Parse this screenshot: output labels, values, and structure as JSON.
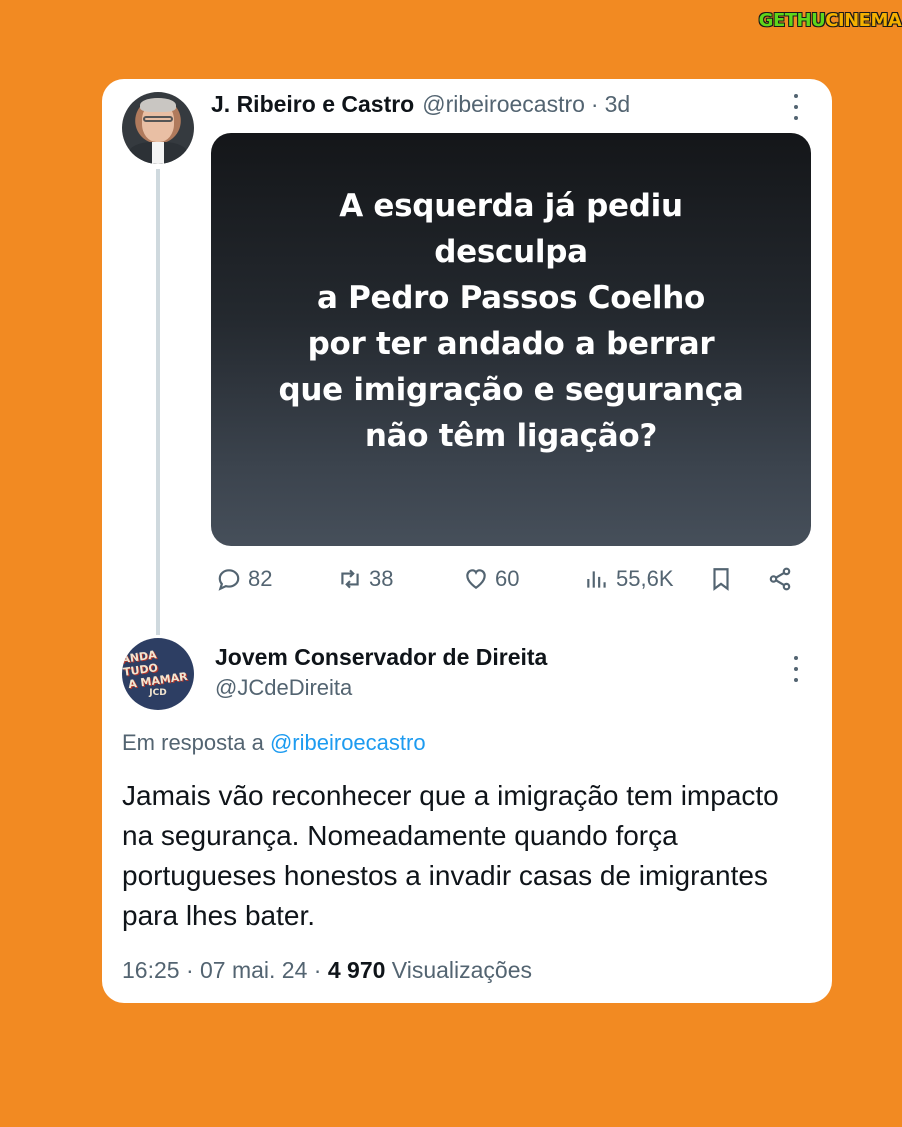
{
  "watermark": {
    "part1": "GETHU",
    "part2": "CINEMA"
  },
  "tweet1": {
    "author_name": "J. Ribeiro e Castro",
    "author_handle": "@ribeiroecastro",
    "separator": "·",
    "time": "3d",
    "image_text_lines": [
      "A esquerda já pediu",
      "desculpa",
      "a Pedro Passos Coelho",
      "por ter andado a berrar",
      "que imigração e segurança",
      "não têm ligação?"
    ],
    "stats": {
      "replies": "82",
      "retweets": "38",
      "likes": "60",
      "views": "55,6K"
    }
  },
  "tweet2": {
    "author_name": "Jovem Conservador de Direita",
    "author_handle": "@JCdeDireita",
    "avatar_text": [
      "ANDA TUDO",
      "A MAMAR",
      "JCD"
    ],
    "reply_prefix": "Em resposta a",
    "reply_mention": "@ribeiroecastro",
    "body": "Jamais vão reconhecer que a imigração tem impacto na segurança. Nomeadamente quando força portugueses honestos a invadir casas de imigrantes para lhes bater.",
    "timestamp": "16:25 · 07 mai. 24 ·",
    "views_count": "4 970",
    "views_label": "Visualizações"
  },
  "colors": {
    "background": "#F28A22",
    "card": "#FFFFFF",
    "text_primary": "#0F1419",
    "text_secondary": "#536471",
    "link": "#1D9BF0",
    "thread_line": "#CFD9DE"
  },
  "icons": [
    "more-icon",
    "reply-icon",
    "retweet-icon",
    "like-icon",
    "views-icon",
    "bookmark-icon",
    "share-icon"
  ]
}
